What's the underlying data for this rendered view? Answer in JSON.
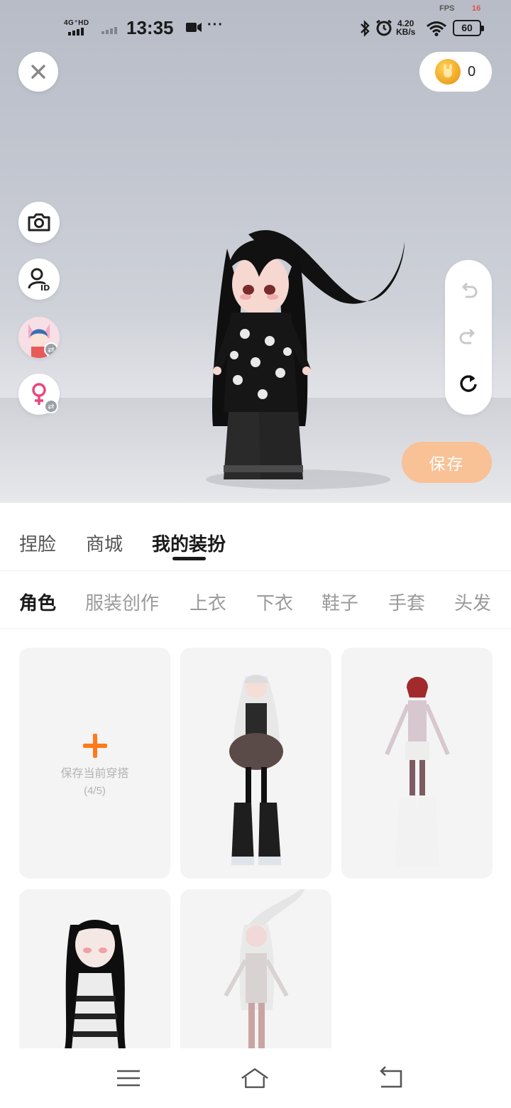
{
  "status_bar": {
    "network": "4G⁺HD",
    "time": "13:35",
    "more": "···",
    "fps_label": "FPS",
    "fps_value": "16",
    "speed_value": "4.20",
    "speed_unit": "KB/s",
    "battery": "60"
  },
  "currency": {
    "amount": "0"
  },
  "actions": {
    "save_label": "保存"
  },
  "tabs": [
    {
      "label": "捏脸",
      "active": false
    },
    {
      "label": "商城",
      "active": false
    },
    {
      "label": "我的装扮",
      "active": true
    }
  ],
  "categories": [
    {
      "label": "角色",
      "active": true
    },
    {
      "label": "服装创作",
      "active": false
    },
    {
      "label": "上衣",
      "active": false
    },
    {
      "label": "下衣",
      "active": false
    },
    {
      "label": "鞋子",
      "active": false
    },
    {
      "label": "手套",
      "active": false
    },
    {
      "label": "头发",
      "active": false
    }
  ],
  "outfits": {
    "add_label": "保存当前穿搭",
    "add_count": "(4/5)"
  },
  "colors": {
    "accent": "#ff7a1a",
    "save_button": "#f9c196",
    "gender_icon": "#e8457c"
  }
}
